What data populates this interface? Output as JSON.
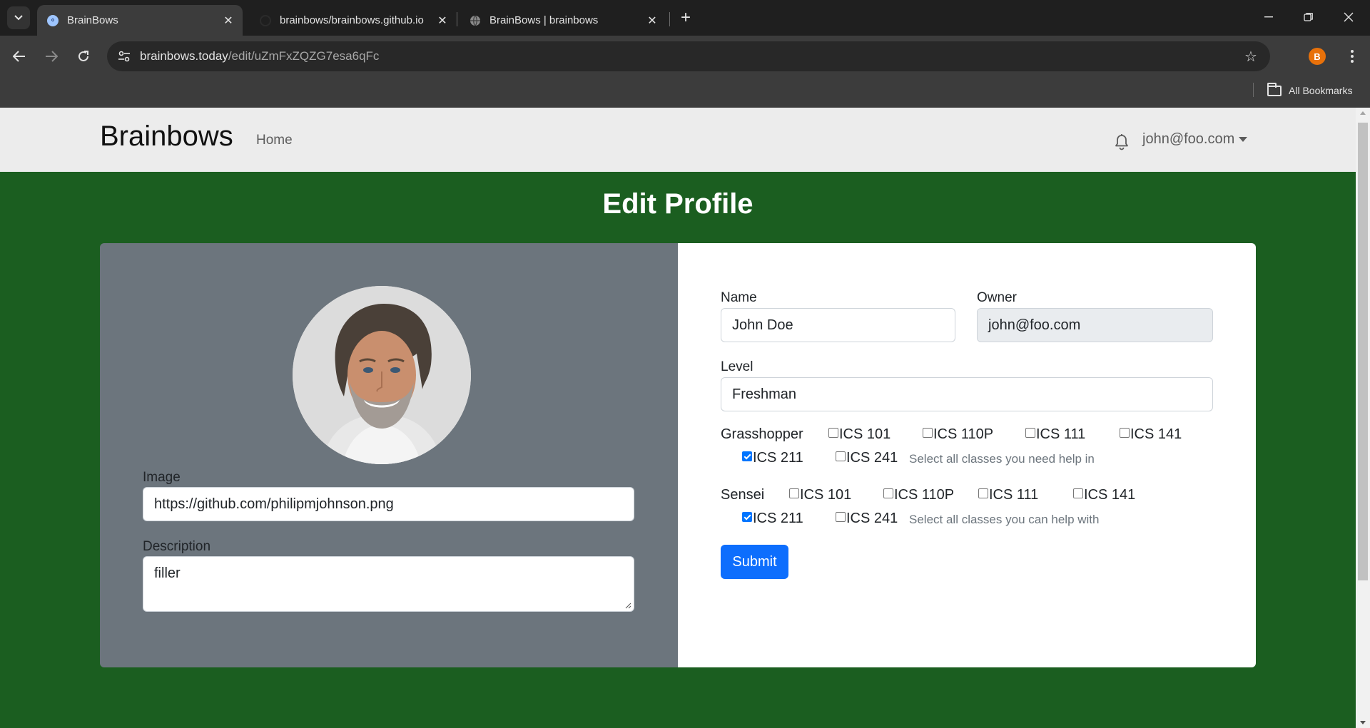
{
  "browser": {
    "tabs": [
      {
        "title": "BrainBows",
        "active": true
      },
      {
        "title": "brainbows/brainbows.github.io",
        "active": false
      },
      {
        "title": "BrainBows | brainbows",
        "active": false
      }
    ],
    "url_host": "brainbows.today",
    "url_path": "/edit/uZmFxZQZG7esa6qFc",
    "profile_initial": "B",
    "all_bookmarks_label": "All Bookmarks"
  },
  "navbar": {
    "brand": "Brainbows",
    "home_link": "Home",
    "user_email": "john@foo.com"
  },
  "page": {
    "title": "Edit Profile"
  },
  "form": {
    "image_label": "Image",
    "image_value": "https://github.com/philipmjohnson.png",
    "description_label": "Description",
    "description_value": "filler",
    "name_label": "Name",
    "name_value": "John Doe",
    "owner_label": "Owner",
    "owner_value": "john@foo.com",
    "level_label": "Level",
    "level_value": "Freshman",
    "grasshopper": {
      "label": "Grasshopper",
      "options": [
        {
          "label": "ICS 101",
          "checked": false
        },
        {
          "label": "ICS 110P",
          "checked": false
        },
        {
          "label": "ICS 111",
          "checked": false
        },
        {
          "label": "ICS 141",
          "checked": false
        },
        {
          "label": "ICS 211",
          "checked": true
        },
        {
          "label": "ICS 241",
          "checked": false
        }
      ],
      "help": "Select all classes you need help in"
    },
    "sensei": {
      "label": "Sensei",
      "options": [
        {
          "label": "ICS 101",
          "checked": false
        },
        {
          "label": "ICS 110P",
          "checked": false
        },
        {
          "label": "ICS 111",
          "checked": false
        },
        {
          "label": "ICS 141",
          "checked": false
        },
        {
          "label": "ICS 211",
          "checked": true
        },
        {
          "label": "ICS 241",
          "checked": false
        }
      ],
      "help": "Select all classes you can help with"
    },
    "submit_label": "Submit"
  },
  "colors": {
    "page_background": "#1b5e20",
    "submit_button": "#0d6efd",
    "left_panel": "#6c757d"
  }
}
